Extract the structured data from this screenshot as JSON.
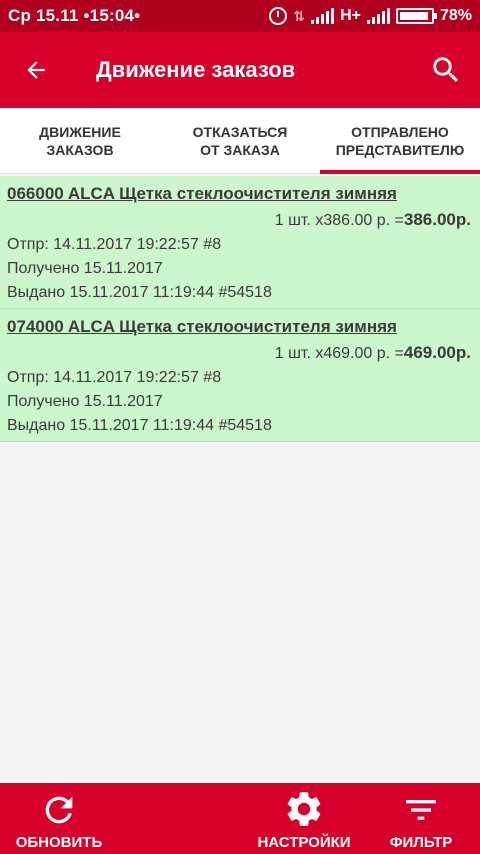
{
  "status_bar": {
    "time": "Ср 15.11 •15:04•",
    "network": "H+",
    "battery_percent": "78%"
  },
  "app_bar": {
    "title": "Движение заказов",
    "back_icon": "arrow-back-icon",
    "search_icon": "search-icon"
  },
  "tabs": [
    {
      "line1": "ДВИЖЕНИЕ",
      "line2": "ЗАКАЗОВ",
      "active": false
    },
    {
      "line1": "ОТКАЗАТЬСЯ",
      "line2": "ОТ ЗАКАЗА",
      "active": false
    },
    {
      "line1": "ОТПРАВЛЕНО",
      "line2": "ПРЕДСТАВИТЕЛЮ",
      "active": true
    }
  ],
  "orders": [
    {
      "name": "066000 ALCA Щетка стеклоочистителя зимняя",
      "qty_price": "1 шт. x386.00 р. =",
      "total": "386.00р.",
      "sent": "Отпр: 14.11.2017 19:22:57  #8",
      "received": "Получено  15.11.2017",
      "issued": "Выдано  15.11.2017 11:19:44  #54518"
    },
    {
      "name": "074000 ALCA Щетка стеклоочистителя зимняя",
      "qty_price": "1 шт. x469.00 р. =",
      "total": "469.00р.",
      "sent": "Отпр: 14.11.2017 19:22:57  #8",
      "received": "Получено  15.11.2017",
      "issued": "Выдано  15.11.2017 11:19:44  #54518"
    }
  ],
  "bottom_bar": {
    "refresh_label": "ОБНОВИТЬ",
    "settings_label": "НАСТРОЙКИ",
    "filter_label": "ФИЛЬТР"
  },
  "colors": {
    "primary": "#d6002b",
    "status_bar": "#b0001e",
    "order_bg": "#ccf6cc"
  }
}
